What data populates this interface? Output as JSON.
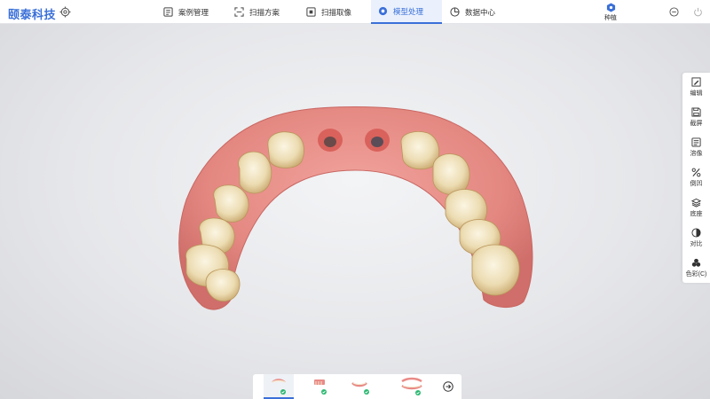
{
  "app": {
    "logo": "颐泰科技"
  },
  "nav": {
    "tabs": [
      {
        "label": "案例管理",
        "icon": "case-management-icon"
      },
      {
        "label": "扫描方案",
        "icon": "scan-plan-icon"
      },
      {
        "label": "扫描取像",
        "icon": "scan-capture-icon"
      },
      {
        "label": "模型处理",
        "icon": "model-processing-icon",
        "active": true
      },
      {
        "label": "数据中心",
        "icon": "data-center-icon"
      }
    ],
    "implant_label": "种植"
  },
  "tools": [
    {
      "label": "编辑",
      "icon": "edit-icon"
    },
    {
      "label": "截屏",
      "icon": "screenshot-icon"
    },
    {
      "label": "溶像",
      "icon": "image-icon"
    },
    {
      "label": "倒凹",
      "icon": "undercut-icon"
    },
    {
      "label": "底座",
      "icon": "base-icon"
    },
    {
      "label": "对比",
      "icon": "contrast-icon"
    },
    {
      "label": "色彩(C)",
      "icon": "color-icon"
    }
  ],
  "colors": {
    "accent": "#3a6fd8",
    "check": "#2eb872",
    "gum": "#e98a86",
    "tooth": "#efe4c4"
  }
}
